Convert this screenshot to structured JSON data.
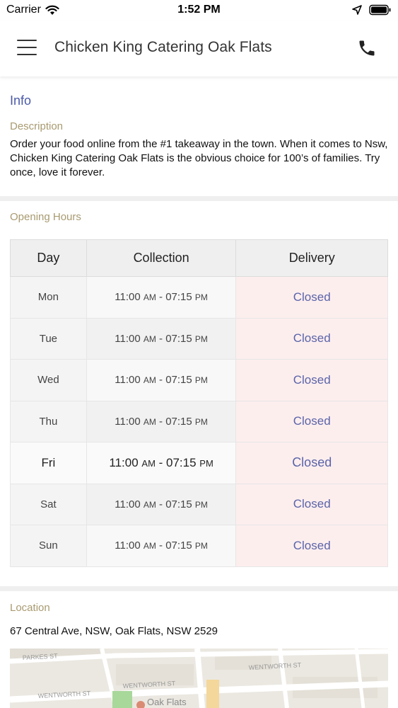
{
  "status_bar": {
    "carrier": "Carrier",
    "time": "1:52 PM"
  },
  "header": {
    "title": "Chicken King Catering Oak Flats",
    "menu_icon": "hamburger-menu-icon",
    "phone_icon": "phone-icon"
  },
  "info": {
    "heading": "Info",
    "description_label": "Description",
    "description": "Order your food online from the #1 takeaway in the town. When it comes to Nsw, Chicken King Catering Oak Flats is the obvious choice for 100’s of families. Try once, love it forever."
  },
  "opening_hours": {
    "label": "Opening Hours",
    "columns": [
      "Day",
      "Collection",
      "Delivery"
    ],
    "rows": [
      {
        "day": "Mon",
        "open": "11:00",
        "open_ampm": "AM",
        "close": "07:15",
        "close_ampm": "PM",
        "delivery": "Closed"
      },
      {
        "day": "Tue",
        "open": "11:00",
        "open_ampm": "AM",
        "close": "07:15",
        "close_ampm": "PM",
        "delivery": "Closed"
      },
      {
        "day": "Wed",
        "open": "11:00",
        "open_ampm": "AM",
        "close": "07:15",
        "close_ampm": "PM",
        "delivery": "Closed"
      },
      {
        "day": "Thu",
        "open": "11:00",
        "open_ampm": "AM",
        "close": "07:15",
        "close_ampm": "PM",
        "delivery": "Closed"
      },
      {
        "day": "Fri",
        "open": "11:00",
        "open_ampm": "AM",
        "close": "07:15",
        "close_ampm": "PM",
        "delivery": "Closed"
      },
      {
        "day": "Sat",
        "open": "11:00",
        "open_ampm": "AM",
        "close": "07:15",
        "close_ampm": "PM",
        "delivery": "Closed"
      },
      {
        "day": "Sun",
        "open": "11:00",
        "open_ampm": "AM",
        "close": "07:15",
        "close_ampm": "PM",
        "delivery": "Closed"
      }
    ]
  },
  "location": {
    "label": "Location",
    "address": "67 Central Ave, NSW, Oak Flats, NSW 2529",
    "map_labels": [
      "PARKES ST",
      "WENTWORTH ST",
      "WENTWORTH ST",
      "WENTWORTH ST",
      "Oak Flats"
    ]
  },
  "colors": {
    "accent": "#4a5aa8",
    "label_gold": "#a89a70",
    "closed_bg": "#fdeeee"
  }
}
